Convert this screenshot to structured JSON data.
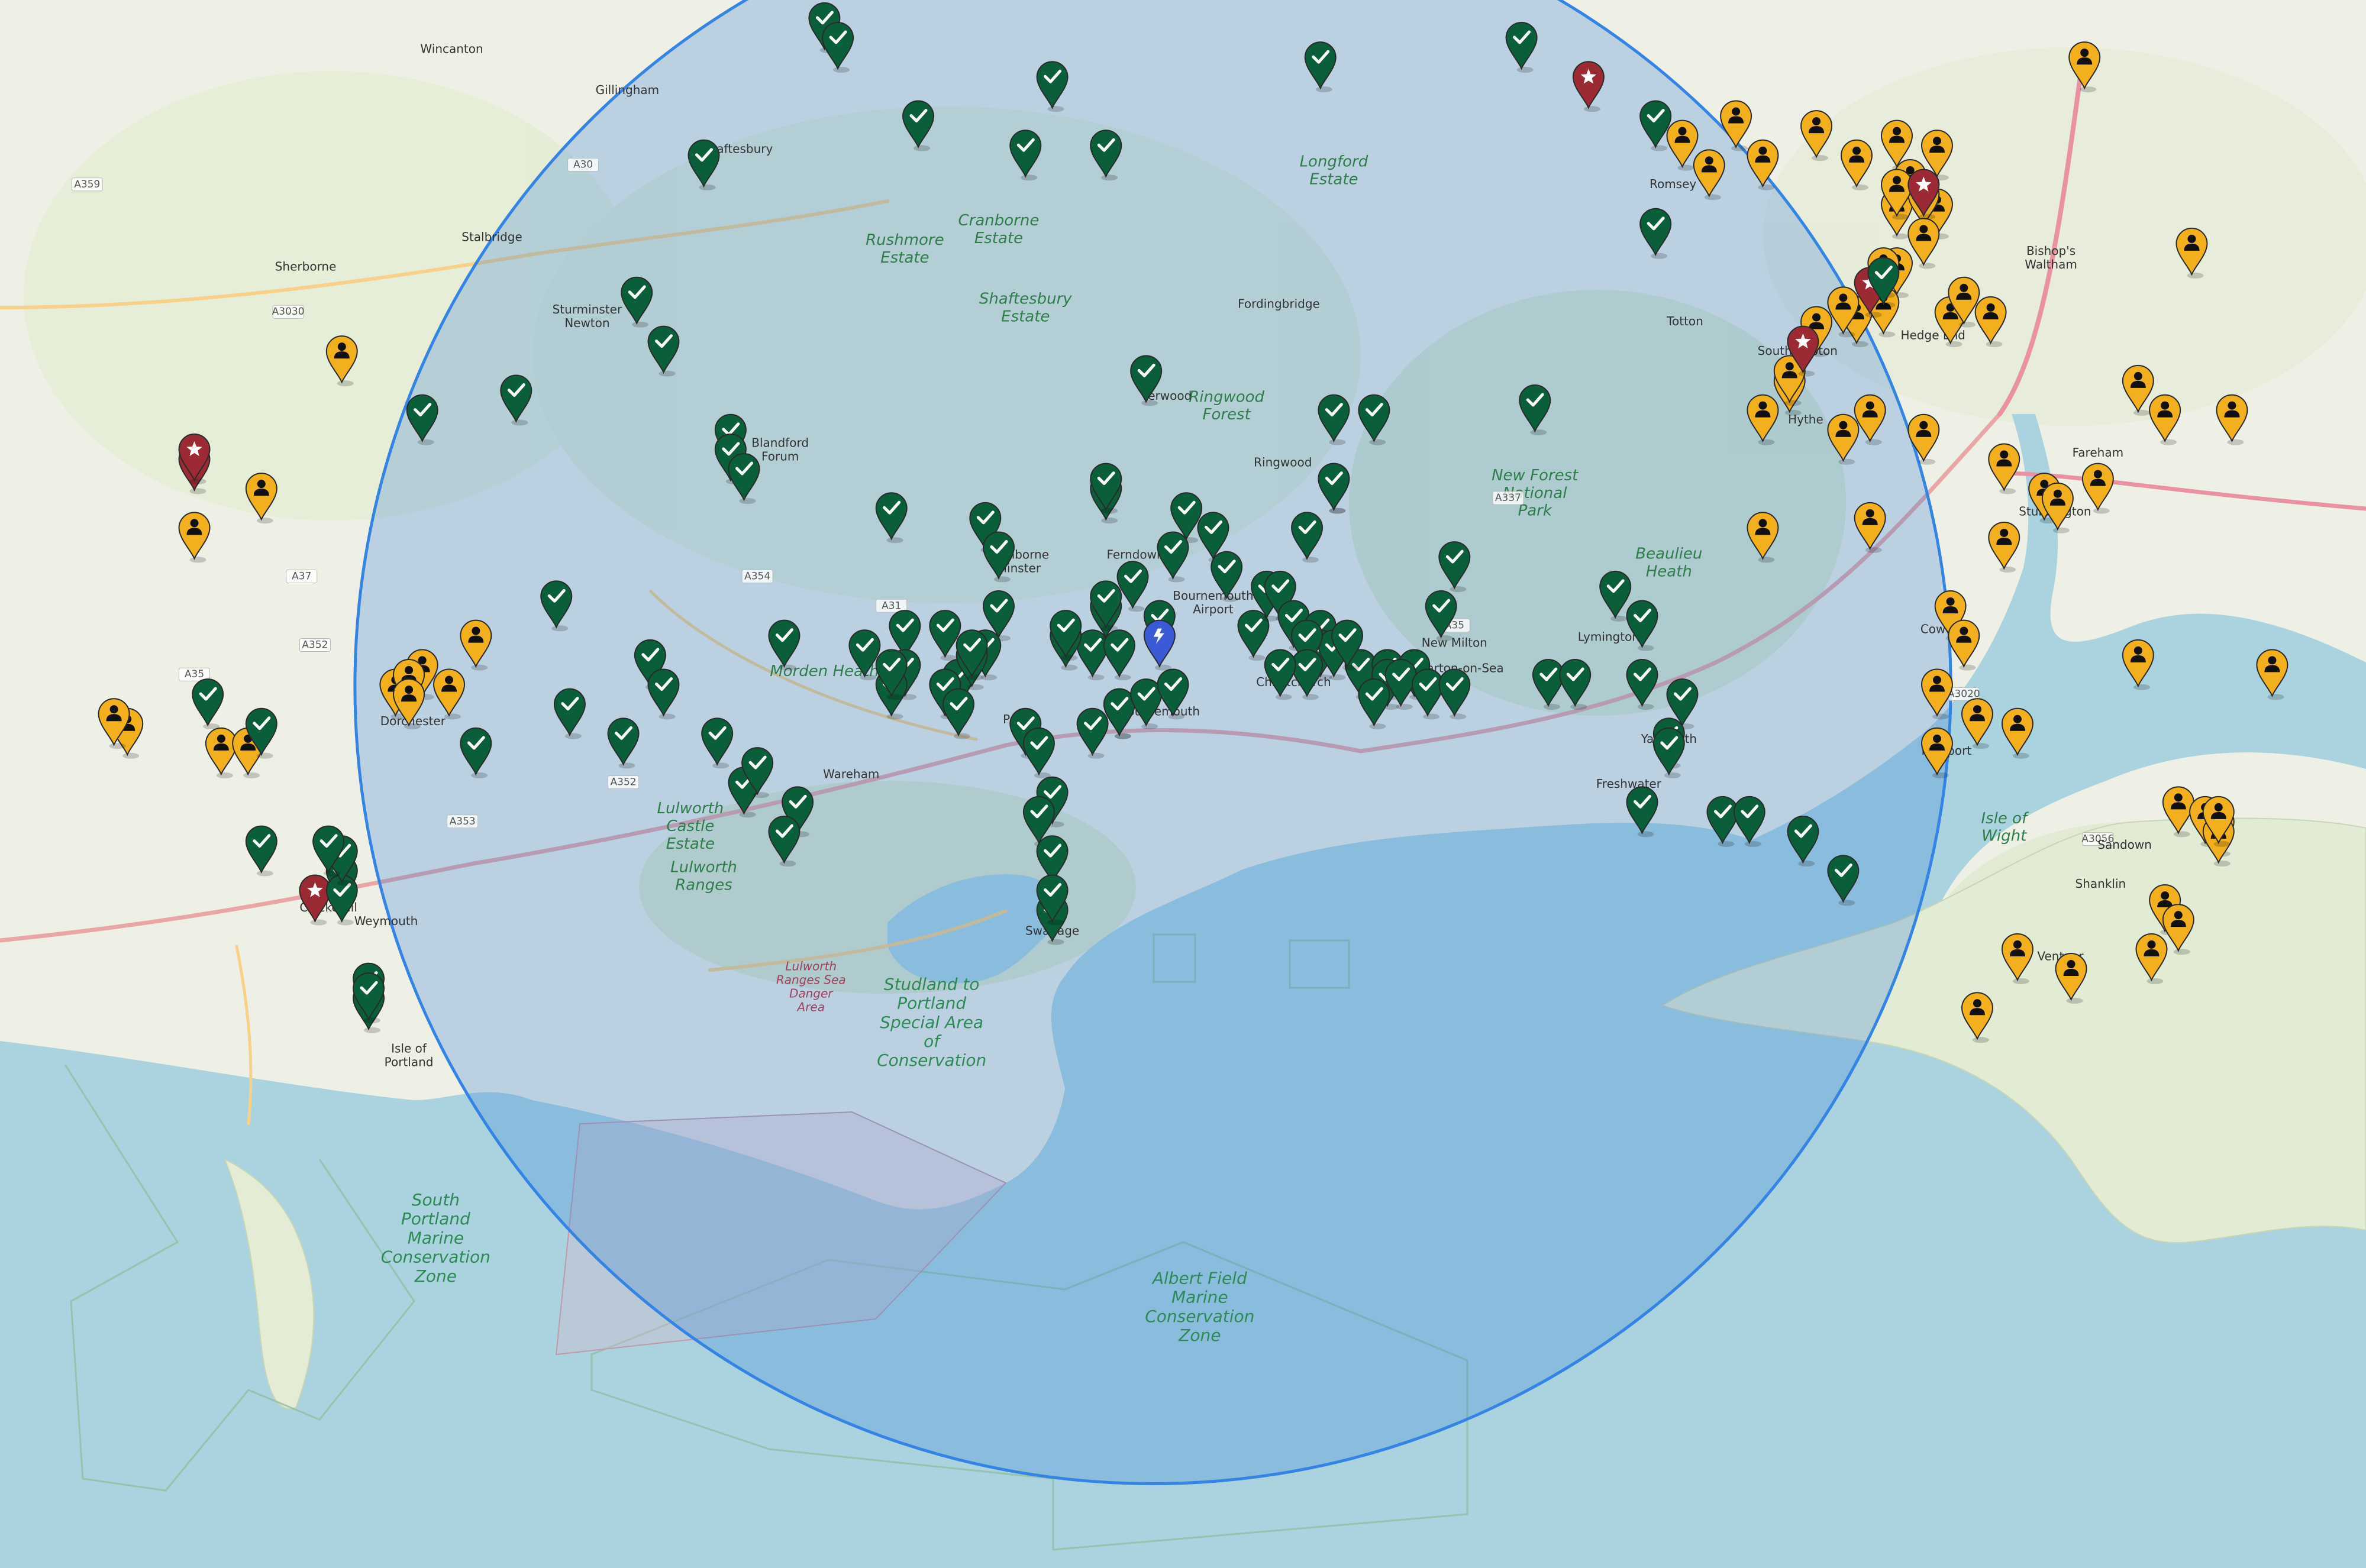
{
  "places": [
    {
      "name": "Wincanton",
      "lat": 51.058,
      "lon": -2.408
    },
    {
      "name": "Gillingham",
      "lat": 51.037,
      "lon": -2.277
    },
    {
      "name": "Shaftesbury",
      "lat": 51.007,
      "lon": -2.195
    },
    {
      "name": "Romsey",
      "lat": 50.989,
      "lon": -1.497
    },
    {
      "name": "Sherborne",
      "lat": 50.947,
      "lon": -2.517
    },
    {
      "name": "Stalbridge",
      "lat": 50.962,
      "lon": -2.378
    },
    {
      "name": "Sturminster Newton",
      "lat": 50.925,
      "lon": -2.307
    },
    {
      "name": "Fordingbridge",
      "lat": 50.928,
      "lon": -1.791
    },
    {
      "name": "Totton",
      "lat": 50.919,
      "lon": -1.488
    },
    {
      "name": "Bishop's Waltham",
      "lat": 50.955,
      "lon": -1.215
    },
    {
      "name": "Hedge End",
      "lat": 50.912,
      "lon": -1.303
    },
    {
      "name": "Southampton",
      "lat": 50.904,
      "lon": -1.404
    },
    {
      "name": "Verwood",
      "lat": 50.881,
      "lon": -1.875
    },
    {
      "name": "Hythe",
      "lat": 50.869,
      "lon": -1.398
    },
    {
      "name": "Fareham",
      "lat": 50.852,
      "lon": -1.18
    },
    {
      "name": "Blandford Forum",
      "lat": 50.857,
      "lon": -2.163
    },
    {
      "name": "Ringwood",
      "lat": 50.847,
      "lon": -1.788
    },
    {
      "name": "Stubbington",
      "lat": 50.822,
      "lon": -1.212
    },
    {
      "name": "Wimborne Minster",
      "lat": 50.8,
      "lon": -1.985
    },
    {
      "name": "Ferndown",
      "lat": 50.8,
      "lon": -1.898
    },
    {
      "name": "Bournemouth Airport",
      "lat": 50.779,
      "lon": -1.84
    },
    {
      "name": "Lymington",
      "lat": 50.758,
      "lon": -1.545
    },
    {
      "name": "Cowes",
      "lat": 50.762,
      "lon": -1.298
    },
    {
      "name": "New Milton",
      "lat": 50.755,
      "lon": -1.66
    },
    {
      "name": "Barton-on-Sea",
      "lat": 50.742,
      "lon": -1.655
    },
    {
      "name": "Bournemouth",
      "lat": 50.72,
      "lon": -1.88
    },
    {
      "name": "Christchurch",
      "lat": 50.735,
      "lon": -1.78
    },
    {
      "name": "Dorchester",
      "lat": 50.715,
      "lon": -2.437
    },
    {
      "name": "Poole",
      "lat": 50.716,
      "lon": -1.985
    },
    {
      "name": "Yarmouth",
      "lat": 50.706,
      "lon": -1.5
    },
    {
      "name": "Newport",
      "lat": 50.7,
      "lon": -1.293
    },
    {
      "name": "Wareham",
      "lat": 50.688,
      "lon": -2.11
    },
    {
      "name": "Freshwater",
      "lat": 50.683,
      "lon": -1.53
    },
    {
      "name": "Sandown",
      "lat": 50.652,
      "lon": -1.16
    },
    {
      "name": "Shanklin",
      "lat": 50.632,
      "lon": -1.178
    },
    {
      "name": "Weymouth",
      "lat": 50.613,
      "lon": -2.457
    },
    {
      "name": "Chickerell",
      "lat": 50.62,
      "lon": -2.5
    },
    {
      "name": "Swanage",
      "lat": 50.608,
      "lon": -1.96
    },
    {
      "name": "Ventnor",
      "lat": 50.595,
      "lon": -1.208
    },
    {
      "name": "Isle of Portland",
      "lat": 50.548,
      "lon": -2.44
    }
  ],
  "areas": [
    {
      "name": "New Forest National Park",
      "style": "park",
      "lat": 50.84,
      "lon": -1.6
    },
    {
      "name": "Lulworth Ranges",
      "style": "park",
      "lat": 50.64,
      "lon": -2.22
    },
    {
      "name": "Morden Heath",
      "style": "park",
      "lat": 50.74,
      "lon": -2.13
    },
    {
      "name": "Rushmore Estate",
      "style": "park",
      "lat": 50.96,
      "lon": -2.07
    },
    {
      "name": "Cranborne Estate",
      "style": "park",
      "lat": 50.97,
      "lon": -2.0
    },
    {
      "name": "Shaftesbury Estate",
      "style": "park",
      "lat": 50.93,
      "lon": -1.98
    },
    {
      "name": "Longford Estate",
      "style": "park",
      "lat": 51.0,
      "lon": -1.75
    },
    {
      "name": "Ringwood Forest",
      "style": "park",
      "lat": 50.88,
      "lon": -1.83
    },
    {
      "name": "Beaulieu Heath",
      "style": "park",
      "lat": 50.8,
      "lon": -1.5
    },
    {
      "name": "Lulworth Castle Estate",
      "style": "park",
      "lat": 50.67,
      "lon": -2.23
    },
    {
      "name": "Studland to Portland Special Area of Conservation",
      "style": "zone",
      "lat": 50.58,
      "lon": -2.05
    },
    {
      "name": "Lulworth Ranges Sea Danger Area",
      "style": "zone-red",
      "lat": 50.59,
      "lon": -2.14
    },
    {
      "name": "South Portland Marine Conservation Zone",
      "style": "zone",
      "lat": 50.47,
      "lon": -2.42
    },
    {
      "name": "Albert Field Marine Conservation Zone",
      "style": "zone",
      "lat": 50.43,
      "lon": -1.85
    },
    {
      "name": "Isle of Wight",
      "style": "park",
      "lat": 50.665,
      "lon": -1.25
    }
  ],
  "roads": [
    {
      "ref": "A30",
      "lat": 51.0,
      "lon": -2.31
    },
    {
      "ref": "A359",
      "lat": 50.99,
      "lon": -2.68
    },
    {
      "ref": "A3030",
      "lat": 50.925,
      "lon": -2.53
    },
    {
      "ref": "A354",
      "lat": 50.79,
      "lon": -2.18
    },
    {
      "ref": "A31",
      "lat": 50.775,
      "lon": -2.08
    },
    {
      "ref": "A35",
      "lat": 50.74,
      "lon": -2.6
    },
    {
      "ref": "A35",
      "lat": 50.765,
      "lon": -1.66
    },
    {
      "ref": "A337",
      "lat": 50.83,
      "lon": -1.62
    },
    {
      "ref": "A352",
      "lat": 50.755,
      "lon": -2.51
    },
    {
      "ref": "A352",
      "lat": 50.685,
      "lon": -2.28
    },
    {
      "ref": "A353",
      "lat": 50.665,
      "lon": -2.4
    },
    {
      "ref": "A3020",
      "lat": 50.73,
      "lon": -1.28
    },
    {
      "ref": "A3056",
      "lat": 50.656,
      "lon": -1.18
    },
    {
      "ref": "A37",
      "lat": 50.79,
      "lon": -2.52
    }
  ],
  "radius_circle": {
    "center": {
      "lat": 50.735,
      "lon": -1.885
    },
    "radius_km": 45,
    "stroke": "#3584e4",
    "fill": "#3b82d6"
  },
  "center_marker": {
    "icon": "charging-station-icon",
    "color": "#3a5ad6",
    "lat": 50.745,
    "lon": -1.88
  },
  "marker_colors": {
    "visited": "#0b5e3a",
    "person": "#f2b01e",
    "favorite": "#9b2a35"
  },
  "markers": {
    "visited": [
      [
        51.06,
        -2.13
      ],
      [
        51.05,
        -2.12
      ],
      [
        51.04,
        -1.76
      ],
      [
        51.05,
        -1.61
      ],
      [
        51.01,
        -1.51
      ],
      [
        51.03,
        -1.96
      ],
      [
        51.01,
        -2.06
      ],
      [
        50.99,
        -2.22
      ],
      [
        50.995,
        -1.98
      ],
      [
        50.995,
        -1.92
      ],
      [
        50.955,
        -1.51
      ],
      [
        50.93,
        -1.34
      ],
      [
        50.92,
        -2.27
      ],
      [
        50.895,
        -2.25
      ],
      [
        50.88,
        -1.89
      ],
      [
        50.86,
        -1.75
      ],
      [
        50.86,
        -1.72
      ],
      [
        50.865,
        -1.6
      ],
      [
        50.87,
        -2.36
      ],
      [
        50.86,
        -2.43
      ],
      [
        50.85,
        -2.2
      ],
      [
        50.84,
        -2.2
      ],
      [
        50.83,
        -2.19
      ],
      [
        50.81,
        -1.86
      ],
      [
        50.79,
        -1.87
      ],
      [
        50.8,
        -1.84
      ],
      [
        50.8,
        -1.77
      ],
      [
        50.78,
        -1.83
      ],
      [
        50.74,
        -1.93
      ],
      [
        50.825,
        -1.75
      ],
      [
        50.825,
        -1.75
      ],
      [
        50.82,
        -1.92
      ],
      [
        50.825,
        -1.92
      ],
      [
        50.81,
        -2.08
      ],
      [
        50.805,
        -2.01
      ],
      [
        50.79,
        -2.0
      ],
      [
        50.75,
        -1.81
      ],
      [
        50.785,
        -1.66
      ],
      [
        50.76,
        -1.67
      ],
      [
        50.775,
        -1.9
      ],
      [
        50.76,
        -1.92
      ],
      [
        50.755,
        -1.88
      ],
      [
        50.74,
        -1.91
      ],
      [
        50.745,
        -1.95
      ],
      [
        50.76,
        -2.0
      ],
      [
        50.765,
        -1.92
      ],
      [
        50.77,
        -1.8
      ],
      [
        50.77,
        -1.79
      ],
      [
        50.755,
        -1.78
      ],
      [
        50.75,
        -1.76
      ],
      [
        50.74,
        -1.76
      ],
      [
        50.74,
        -1.75
      ],
      [
        50.73,
        -1.73
      ],
      [
        50.745,
        -1.74
      ],
      [
        50.745,
        -1.77
      ],
      [
        50.73,
        -1.77
      ],
      [
        50.73,
        -1.79
      ],
      [
        50.73,
        -1.71
      ],
      [
        50.725,
        -1.71
      ],
      [
        50.73,
        -1.69
      ],
      [
        50.725,
        -1.7
      ],
      [
        50.715,
        -1.72
      ],
      [
        50.72,
        -1.68
      ],
      [
        50.72,
        -1.66
      ],
      [
        50.725,
        -1.59
      ],
      [
        50.725,
        -1.57
      ],
      [
        50.725,
        -1.52
      ],
      [
        50.715,
        -1.49
      ],
      [
        50.77,
        -1.54
      ],
      [
        50.755,
        -1.52
      ],
      [
        50.695,
        -1.5
      ],
      [
        50.69,
        -1.5
      ],
      [
        50.66,
        -1.52
      ],
      [
        50.655,
        -1.46
      ],
      [
        50.655,
        -1.44
      ],
      [
        50.645,
        -1.4
      ],
      [
        50.625,
        -1.37
      ],
      [
        50.745,
        -2.16
      ],
      [
        50.74,
        -2.1
      ],
      [
        50.75,
        -2.07
      ],
      [
        50.73,
        -2.07
      ],
      [
        50.725,
        -2.03
      ],
      [
        50.75,
        -2.04
      ],
      [
        50.74,
        -2.01
      ],
      [
        50.735,
        -2.02
      ],
      [
        50.72,
        -2.08
      ],
      [
        50.73,
        -2.08
      ],
      [
        50.72,
        -2.04
      ],
      [
        50.71,
        -2.03
      ],
      [
        50.74,
        -2.02
      ],
      [
        50.75,
        -1.95
      ],
      [
        50.765,
        -2.33
      ],
      [
        50.735,
        -2.26
      ],
      [
        50.71,
        -2.32
      ],
      [
        50.69,
        -2.39
      ],
      [
        50.72,
        -2.25
      ],
      [
        50.695,
        -2.21
      ],
      [
        50.67,
        -2.19
      ],
      [
        50.68,
        -2.18
      ],
      [
        50.66,
        -2.15
      ],
      [
        50.645,
        -2.16
      ],
      [
        50.7,
        -1.98
      ],
      [
        50.69,
        -1.97
      ],
      [
        50.665,
        -1.96
      ],
      [
        50.655,
        -1.97
      ],
      [
        50.635,
        -1.96
      ],
      [
        50.605,
        -1.96
      ],
      [
        50.615,
        -1.96
      ],
      [
        50.695,
        -2.28
      ],
      [
        50.64,
        -2.55
      ],
      [
        50.625,
        -2.49
      ],
      [
        50.615,
        -2.49
      ],
      [
        50.635,
        -2.49
      ],
      [
        50.64,
        -2.5
      ],
      [
        50.57,
        -2.47
      ],
      [
        50.56,
        -2.47
      ],
      [
        50.565,
        -2.47
      ],
      [
        50.7,
        -2.55
      ],
      [
        50.715,
        -2.59
      ],
      [
        50.7,
        -1.93
      ],
      [
        50.71,
        -1.91
      ],
      [
        50.71,
        -1.91
      ],
      [
        50.715,
        -1.89
      ],
      [
        50.72,
        -1.87
      ]
    ],
    "person": [
      [
        51.0,
        -1.49
      ],
      [
        50.99,
        -1.43
      ],
      [
        50.985,
        -1.47
      ],
      [
        51.01,
        -1.45
      ],
      [
        51.005,
        -1.39
      ],
      [
        50.99,
        -1.36
      ],
      [
        51.0,
        -1.33
      ],
      [
        50.995,
        -1.3
      ],
      [
        50.98,
        -1.32
      ],
      [
        51.04,
        -1.19
      ],
      [
        50.965,
        -1.33
      ],
      [
        50.965,
        -1.3
      ],
      [
        50.97,
        -1.31
      ],
      [
        50.975,
        -1.33
      ],
      [
        50.95,
        -1.31
      ],
      [
        50.935,
        -1.33
      ],
      [
        50.91,
        -1.36
      ],
      [
        50.915,
        -1.34
      ],
      [
        50.91,
        -1.26
      ],
      [
        50.91,
        -1.29
      ],
      [
        50.915,
        -1.37
      ],
      [
        50.92,
        -1.28
      ],
      [
        50.945,
        -1.11
      ],
      [
        50.875,
        -1.41
      ],
      [
        50.88,
        -1.41
      ],
      [
        50.86,
        -1.43
      ],
      [
        50.86,
        -1.35
      ],
      [
        50.85,
        -1.31
      ],
      [
        50.85,
        -1.37
      ],
      [
        50.835,
        -1.25
      ],
      [
        50.82,
        -1.22
      ],
      [
        50.815,
        -1.21
      ],
      [
        50.875,
        -1.15
      ],
      [
        50.86,
        -1.13
      ],
      [
        50.86,
        -1.08
      ],
      [
        50.825,
        -1.18
      ],
      [
        50.805,
        -1.35
      ],
      [
        50.8,
        -1.43
      ],
      [
        50.795,
        -1.25
      ],
      [
        50.76,
        -1.29
      ],
      [
        50.745,
        -1.28
      ],
      [
        50.72,
        -1.3
      ],
      [
        50.705,
        -1.27
      ],
      [
        50.7,
        -1.24
      ],
      [
        50.69,
        -1.3
      ],
      [
        50.735,
        -1.15
      ],
      [
        50.73,
        -1.05
      ],
      [
        50.66,
        -1.12
      ],
      [
        50.65,
        -1.09
      ],
      [
        50.655,
        -1.1
      ],
      [
        50.645,
        -1.09
      ],
      [
        50.655,
        -1.09
      ],
      [
        50.61,
        -1.13
      ],
      [
        50.6,
        -1.12
      ],
      [
        50.585,
        -1.14
      ],
      [
        50.585,
        -1.24
      ],
      [
        50.575,
        -1.2
      ],
      [
        50.555,
        -1.27
      ],
      [
        50.905,
        -1.39
      ],
      [
        50.935,
        -1.34
      ],
      [
        50.82,
        -2.55
      ],
      [
        50.89,
        -2.49
      ],
      [
        50.73,
        -2.43
      ],
      [
        50.72,
        -2.45
      ],
      [
        50.725,
        -2.44
      ],
      [
        50.715,
        -2.44
      ],
      [
        50.72,
        -2.41
      ],
      [
        50.69,
        -2.58
      ],
      [
        50.69,
        -2.56
      ],
      [
        50.8,
        -2.6
      ],
      [
        50.745,
        -2.39
      ],
      [
        50.7,
        -2.65
      ],
      [
        50.705,
        -2.66
      ]
    ],
    "favorite": [
      [
        51.03,
        -1.56
      ],
      [
        50.975,
        -1.31
      ],
      [
        50.925,
        -1.35
      ],
      [
        50.895,
        -1.4
      ],
      [
        50.835,
        -2.6
      ],
      [
        50.84,
        -2.6
      ],
      [
        50.615,
        -2.51
      ]
    ]
  }
}
